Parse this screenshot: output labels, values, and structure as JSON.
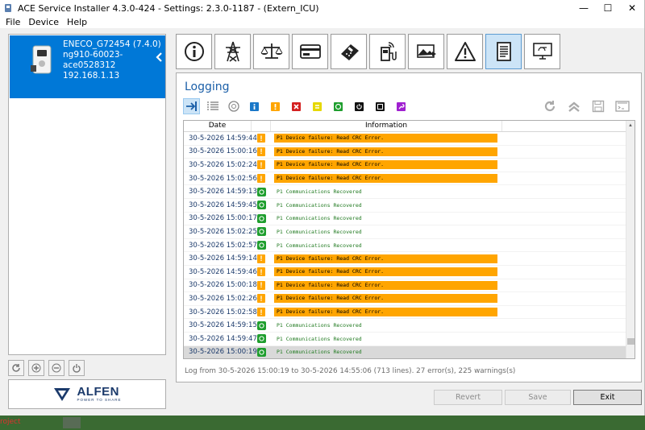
{
  "window": {
    "title": "ACE Service Installer 4.3.0-424 - Settings: 2.3.0-1187 -  (Extern_ICU)",
    "minimize": "—",
    "maximize": "☐",
    "close": "✕"
  },
  "menu": [
    "File",
    "Device",
    "Help"
  ],
  "device": {
    "name": "ENECO_G72454 (7.4.0)",
    "serial": "ng910-60023-ace0528312",
    "ip": "192.168.1.13"
  },
  "brand": {
    "name": "ALFEN",
    "tagline": "POWER TO SHARE"
  },
  "tabs": [
    {
      "icon": "info-icon"
    },
    {
      "icon": "power-pylon-icon"
    },
    {
      "icon": "balance-icon"
    },
    {
      "icon": "card-reader-icon"
    },
    {
      "icon": "payment-terminal-icon"
    },
    {
      "icon": "charging-station-icon"
    },
    {
      "icon": "image-chart-icon"
    },
    {
      "icon": "warning-icon"
    },
    {
      "icon": "document-icon",
      "active": true
    },
    {
      "icon": "remote-screen-icon"
    }
  ],
  "logging": {
    "title": "Logging",
    "columns": {
      "date": "Date",
      "info": "Information"
    },
    "rows": [
      {
        "date": "30-5-2026 14:59:44",
        "type": "warning",
        "text": "P1 Device failure: Read CRC Error."
      },
      {
        "date": "30-5-2026 15:00:16",
        "type": "warning",
        "text": "P1 Device failure: Read CRC Error."
      },
      {
        "date": "30-5-2026 15:02:24",
        "type": "warning",
        "text": "P1 Device failure: Read CRC Error."
      },
      {
        "date": "30-5-2026 15:02:56",
        "type": "warning",
        "text": "P1 Device failure: Read CRC Error."
      },
      {
        "date": "30-5-2026 14:59:13",
        "type": "ok",
        "text": "P1 Communications Recovered"
      },
      {
        "date": "30-5-2026 14:59:45",
        "type": "ok",
        "text": "P1 Communications Recovered"
      },
      {
        "date": "30-5-2026 15:00:17",
        "type": "ok",
        "text": "P1 Communications Recovered"
      },
      {
        "date": "30-5-2026 15:02:25",
        "type": "ok",
        "text": "P1 Communications Recovered"
      },
      {
        "date": "30-5-2026 15:02:57",
        "type": "ok",
        "text": "P1 Communications Recovered"
      },
      {
        "date": "30-5-2026 14:59:14",
        "type": "warning",
        "text": "P1 Device failure: Read CRC Error."
      },
      {
        "date": "30-5-2026 14:59:46",
        "type": "warning",
        "text": "P1 Device failure: Read CRC Error."
      },
      {
        "date": "30-5-2026 15:00:18",
        "type": "warning",
        "text": "P1 Device failure: Read CRC Error."
      },
      {
        "date": "30-5-2026 15:02:26",
        "type": "warning",
        "text": "P1 Device failure: Read CRC Error."
      },
      {
        "date": "30-5-2026 15:02:58",
        "type": "warning",
        "text": "P1 Device failure: Read CRC Error."
      },
      {
        "date": "30-5-2026 14:59:15",
        "type": "ok",
        "text": "P1 Communications Recovered"
      },
      {
        "date": "30-5-2026 14:59:47",
        "type": "ok",
        "text": "P1 Communications Recovered"
      },
      {
        "date": "30-5-2026 15:00:19",
        "type": "ok",
        "text": "P1 Communications Recovered",
        "selected": true
      }
    ],
    "summary": "Log from 30-5-2026 15:00:19 to 30-5-2026 14:55:06 (713 lines). 27 error(s), 225 warnings(s)",
    "scroll_position": 0.97
  },
  "buttons": {
    "revert": "Revert",
    "save": "Save",
    "exit": "Exit"
  },
  "taskbar": {
    "label": "roject"
  },
  "colors": {
    "accent": "#0078d7",
    "warning": "#ffa500",
    "ok": "#1f9e2e",
    "title": "#1b5fa8"
  }
}
